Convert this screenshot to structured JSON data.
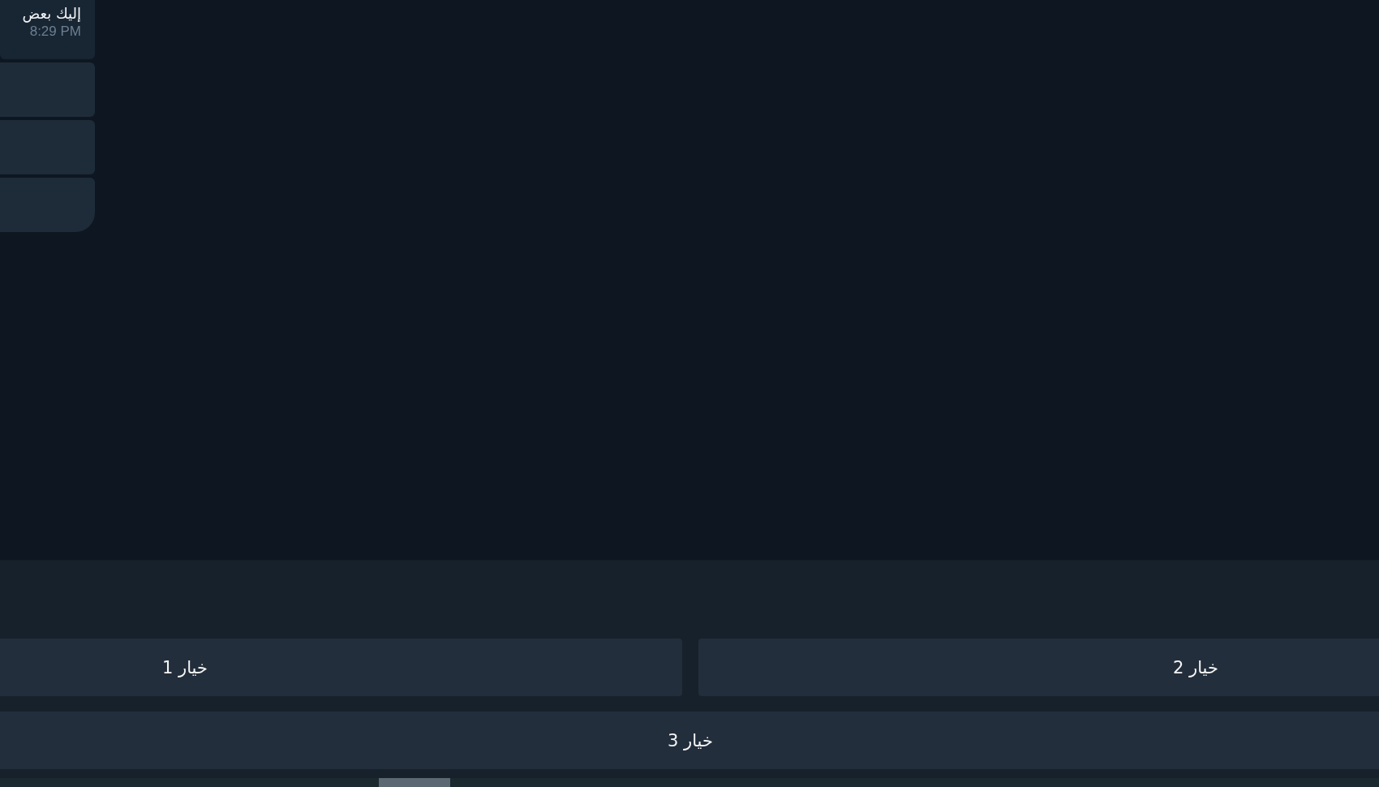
{
  "message": {
    "text": "إليك بعض",
    "time": "8:29 PM"
  },
  "inline_buttons": [
    {
      "kind": "button"
    },
    {
      "kind": "button"
    },
    {
      "kind": "button"
    }
  ],
  "keyboard": {
    "rows": [
      [
        "خيار 2",
        "خيار 1"
      ],
      [
        "خيار 3"
      ]
    ]
  }
}
